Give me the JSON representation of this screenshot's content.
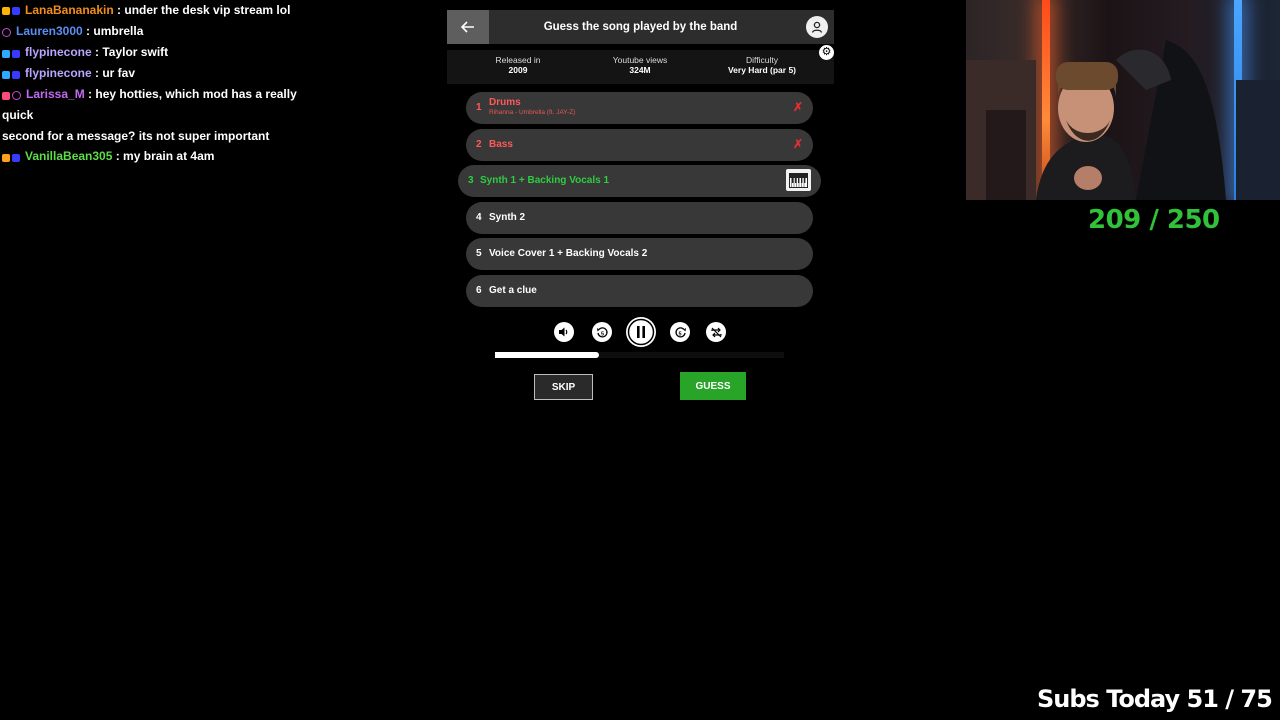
{
  "chat": {
    "messages": [
      {
        "user": "LanaBananakin",
        "text": " : under the desk vip stream lol",
        "color": "#f28d1c",
        "badges": [
          "#ffb400",
          "#3a3aff"
        ]
      },
      {
        "user": "Lauren3000",
        "text": " : umbrella",
        "color": "#5a8ef5",
        "badges": [
          "circle:#c44bd9"
        ]
      },
      {
        "user": "flypinecone",
        "text": " : Taylor swift",
        "color": "#b9a4ff",
        "badges": [
          "#2fa8ff",
          "#3a3aff"
        ]
      },
      {
        "user": "flypinecone",
        "text": " : ur fav",
        "color": "#b9a4ff",
        "badges": [
          "#2fa8ff",
          "#3a3aff"
        ]
      },
      {
        "user": "Larissa_M",
        "text": " : hey hotties, which mod has a really quick",
        "text2": "second for a message? its not super important",
        "color": "#c26bf0",
        "badges": [
          "#ff4a7a",
          "circle:#c44bd9"
        ]
      },
      {
        "user": "VanillaBean305",
        "text": " : my brain at 4am",
        "color": "#5edc4a",
        "badges": [
          "#ff9f1a",
          "#3a3aff"
        ]
      }
    ]
  },
  "game": {
    "title": "Guess the song played by the band",
    "info": {
      "released_label": "Released in",
      "released_value": "2009",
      "views_label": "Youtube views",
      "views_value": "324M",
      "difficulty_label": "Difficulty",
      "difficulty_value": "Very Hard (par 5)"
    },
    "tracks": [
      {
        "num": "1",
        "label": "Drums",
        "sub": "Rihanna - Umbrella (ft. JAY-Z)",
        "state": "failed",
        "mark": "✗"
      },
      {
        "num": "2",
        "label": "Bass",
        "state": "failed",
        "mark": "✗"
      },
      {
        "num": "3",
        "label": "Synth 1 + Backing Vocals 1",
        "state": "current"
      },
      {
        "num": "4",
        "label": "Synth 2",
        "state": "locked"
      },
      {
        "num": "5",
        "label": "Voice Cover 1 + Backing Vocals 2",
        "state": "locked"
      },
      {
        "num": "6",
        "label": "Get a clue",
        "state": "locked"
      }
    ],
    "playback_progress": 0.36,
    "skip_label": "SKIP",
    "guess_label": "GUESS"
  },
  "overlay": {
    "score": "209 / 250",
    "subs": "Subs Today  51 / 75"
  },
  "colors": {
    "accent_green": "#28a428",
    "failed_red": "#ff5959",
    "current_green": "#2ecc40"
  }
}
